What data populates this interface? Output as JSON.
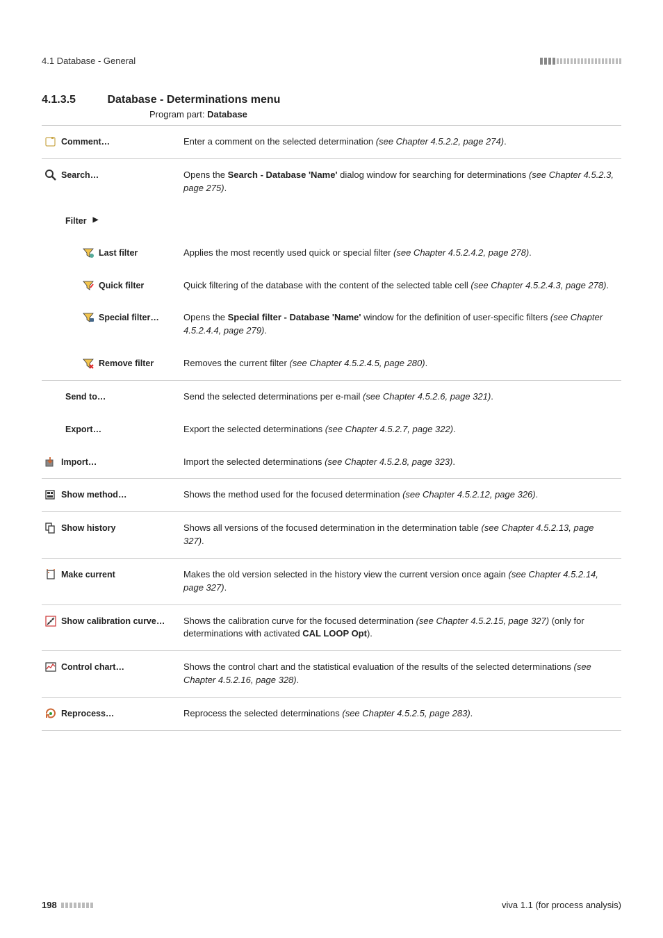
{
  "header": {
    "section": "4.1 Database - General"
  },
  "heading": {
    "num": "4.1.3.5",
    "title": "Database - Determinations menu"
  },
  "subheading": {
    "prefix": "Program part: ",
    "bold": "Database"
  },
  "rows": [
    {
      "label": "Comment…",
      "desc_pre": "Enter a comment on the selected determination ",
      "desc_italic": "(see Chapter 4.5.2.2, page 274)",
      "desc_post": "."
    },
    {
      "label": "Search…",
      "desc_pre": "Opens the ",
      "desc_bold": "Search - Database 'Name'",
      "desc_mid": " dialog window for searching for determinations ",
      "desc_italic": "(see Chapter 4.5.2.3, page 275)",
      "desc_post": "."
    },
    {
      "label": "Filter",
      "desc": ""
    },
    {
      "label": "Last filter",
      "desc_pre": "Applies the most recently used quick or special filter ",
      "desc_italic": "(see Chapter 4.5.2.4.2, page 278)",
      "desc_post": "."
    },
    {
      "label": "Quick filter",
      "desc_pre": "Quick filtering of the database with the content of the selected table cell ",
      "desc_italic": "(see Chapter 4.5.2.4.3, page 278)",
      "desc_post": "."
    },
    {
      "label": "Special filter…",
      "desc_pre": "Opens the ",
      "desc_bold": "Special filter - Database 'Name'",
      "desc_mid": " window for the definition of user-specific filters ",
      "desc_italic": "(see Chapter 4.5.2.4.4, page 279)",
      "desc_post": "."
    },
    {
      "label": "Remove filter",
      "desc_pre": "Removes the current filter ",
      "desc_italic": "(see Chapter 4.5.2.4.5, page 280)",
      "desc_post": "."
    },
    {
      "label": "Send to…",
      "desc_pre": "Send the selected determinations per e-mail ",
      "desc_italic": "(see Chapter 4.5.2.6, page 321)",
      "desc_post": "."
    },
    {
      "label": "Export…",
      "desc_pre": "Export the selected determinations ",
      "desc_italic": "(see Chapter 4.5.2.7, page 322)",
      "desc_post": "."
    },
    {
      "label": "Import…",
      "desc_pre": "Import the selected determinations ",
      "desc_italic": "(see Chapter 4.5.2.8, page 323)",
      "desc_post": "."
    },
    {
      "label": "Show method…",
      "desc_pre": "Shows the method used for the focused determination ",
      "desc_italic": "(see Chapter 4.5.2.12, page 326)",
      "desc_post": "."
    },
    {
      "label": "Show history",
      "desc_pre": "Shows all versions of the focused determination in the determination table ",
      "desc_italic": "(see Chapter 4.5.2.13, page 327)",
      "desc_post": "."
    },
    {
      "label": "Make current",
      "desc_pre": "Makes the old version selected in the history view the current version once again ",
      "desc_italic": "(see Chapter 4.5.2.14, page 327)",
      "desc_post": "."
    },
    {
      "label": "Show calibration curve…",
      "desc_pre": "Shows the calibration curve for the focused determination ",
      "desc_italic": "(see Chapter 4.5.2.15, page 327)",
      "desc_mid2": " (only for determinations with activated ",
      "desc_bold2": "CAL LOOP Opt",
      "desc_post": ")."
    },
    {
      "label": "Control chart…",
      "desc_pre": "Shows the control chart and the statistical evaluation of the results of the selected determinations ",
      "desc_italic": "(see Chapter 4.5.2.16, page 328)",
      "desc_post": "."
    },
    {
      "label": "Reprocess…",
      "desc_pre": "Reprocess the selected determinations ",
      "desc_italic": "(see Chapter 4.5.2.5, page 283)",
      "desc_post": "."
    }
  ],
  "footer": {
    "page": "198",
    "right": "viva 1.1 (for process analysis)"
  }
}
